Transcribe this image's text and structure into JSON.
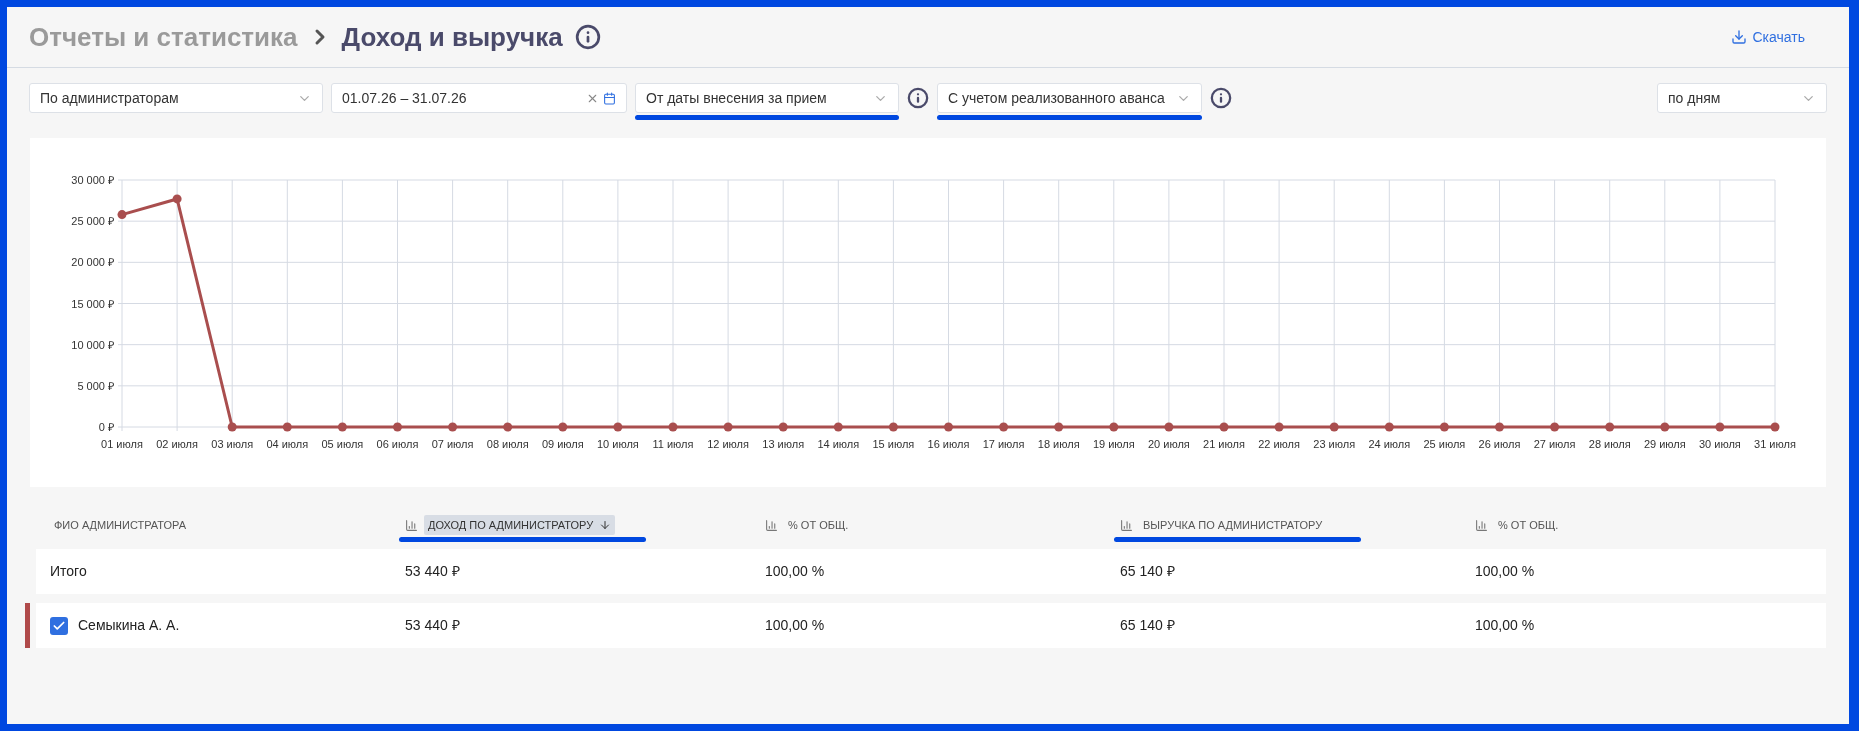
{
  "header": {
    "breadcrumb": "Отчеты и статистика",
    "title": "Доход и выручка",
    "download": "Скачать"
  },
  "filters": [
    {
      "kind": "select",
      "value": "По администраторам",
      "highlighted": false,
      "info": false
    },
    {
      "kind": "date",
      "value": "01.07.26 – 31.07.26",
      "highlighted": false,
      "info": false
    },
    {
      "kind": "select",
      "value": "От даты внесения за прием",
      "highlighted": true,
      "info": true
    },
    {
      "kind": "select",
      "value": "С учетом реализованного аванса",
      "highlighted": true,
      "info": true
    }
  ],
  "period": {
    "value": "по дням"
  },
  "chart_data": {
    "type": "line",
    "grid": true,
    "categories": [
      "01 июля",
      "02 июля",
      "03 июля",
      "04 июля",
      "05 июля",
      "06 июля",
      "07 июля",
      "08 июля",
      "09 июля",
      "10 июля",
      "11 июля",
      "12 июля",
      "13 июля",
      "14 июля",
      "15 июля",
      "16 июля",
      "17 июля",
      "18 июля",
      "19 июля",
      "20 июля",
      "21 июля",
      "22 июля",
      "23 июля",
      "24 июля",
      "25 июля",
      "26 июля",
      "27 июля",
      "28 июля",
      "29 июля",
      "30 июля",
      "31 июля"
    ],
    "series": [
      {
        "color": "#a94e4e",
        "marker": true,
        "values": [
          25800,
          27700,
          0,
          0,
          0,
          0,
          0,
          0,
          0,
          0,
          0,
          0,
          0,
          0,
          0,
          0,
          0,
          0,
          0,
          0,
          0,
          0,
          0,
          0,
          0,
          0,
          0,
          0,
          0,
          0,
          0
        ]
      }
    ],
    "ylim": [
      0,
      30000
    ],
    "yticks": [
      {
        "value": 0,
        "label": "0 ₽"
      },
      {
        "value": 5000,
        "label": "5 000 ₽"
      },
      {
        "value": 10000,
        "label": "10 000 ₽"
      },
      {
        "value": 15000,
        "label": "15 000 ₽"
      },
      {
        "value": 20000,
        "label": "20 000 ₽"
      },
      {
        "value": 25000,
        "label": "25 000 ₽"
      },
      {
        "value": 30000,
        "label": "30 000 ₽"
      }
    ]
  },
  "table": {
    "columns": [
      {
        "label": "ФИО АДМИНИСТРАТОРА",
        "chart_icon": false,
        "sorted": false,
        "highlighted": false
      },
      {
        "label": "ДОХОД ПО АДМИНИСТРАТОРУ",
        "chart_icon": true,
        "sorted": true,
        "highlighted": true
      },
      {
        "label": "% ОТ ОБЩ.",
        "chart_icon": true,
        "sorted": false,
        "highlighted": false
      },
      {
        "label": "ВЫРУЧКА ПО АДМИНИСТРАТОРУ",
        "chart_icon": true,
        "sorted": false,
        "highlighted": true
      },
      {
        "label": "% ОТ ОБЩ.",
        "chart_icon": true,
        "sorted": false,
        "highlighted": false
      }
    ],
    "rows": [
      {
        "kind": "total",
        "cells": [
          "Итого",
          "53 440 ₽",
          "100,00 %",
          "65 140 ₽",
          "100,00 %"
        ]
      },
      {
        "kind": "item",
        "checked": true,
        "color": "#b04a4a",
        "cells": [
          "Семыкина А. А.",
          "53 440 ₽",
          "100,00 %",
          "65 140 ₽",
          "100,00 %"
        ]
      }
    ]
  }
}
